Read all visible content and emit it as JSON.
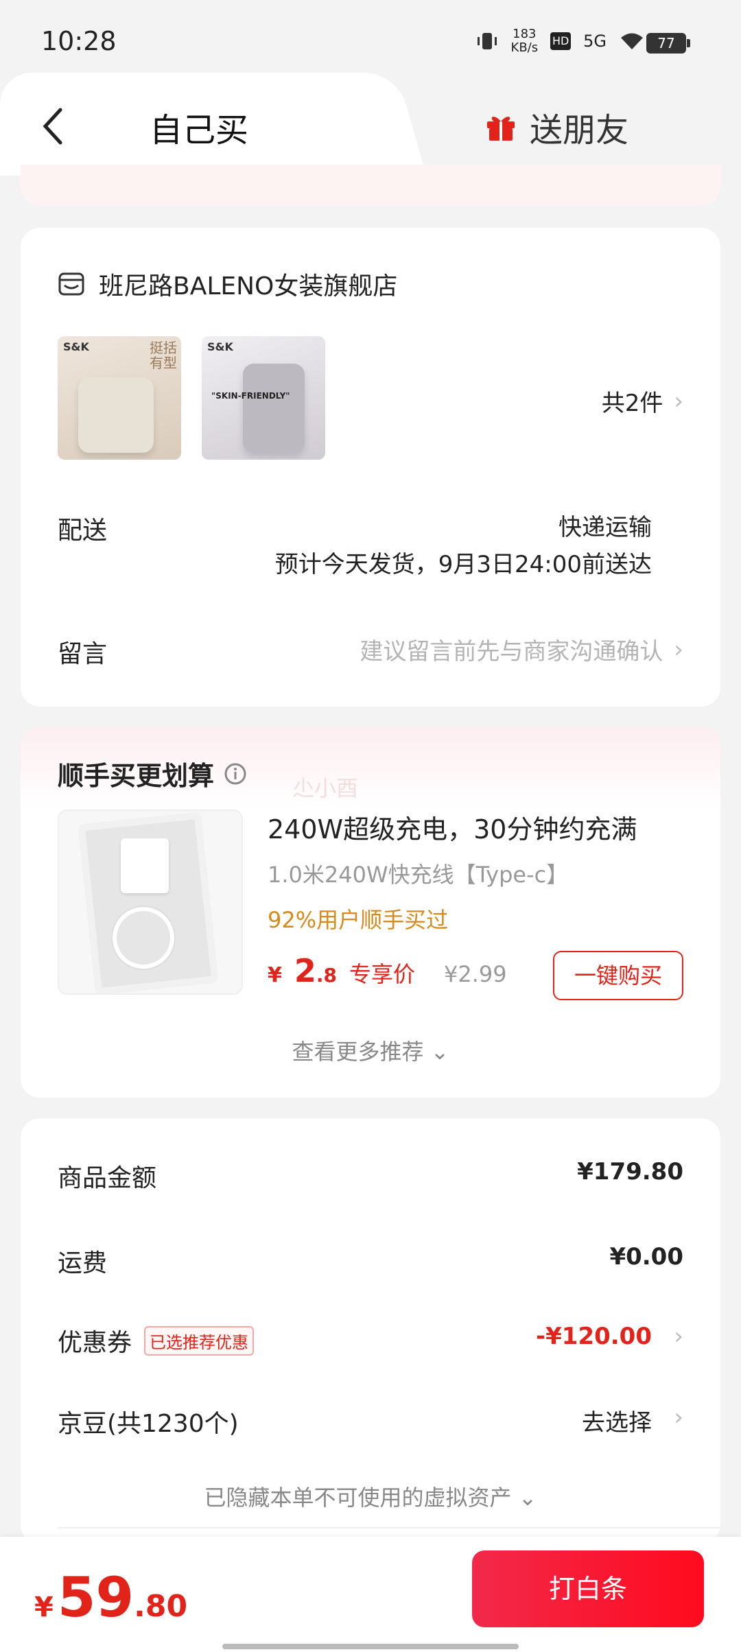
{
  "status_bar": {
    "time": "10:28",
    "net_speed_value": "183",
    "net_speed_unit": "KB/s",
    "hd": "HD",
    "network": "5G",
    "battery": "77"
  },
  "tabs": {
    "self_label": "自己买",
    "friend_label": "送朋友"
  },
  "shop": {
    "name": "班尼路BALENO女装旗舰店",
    "thumbs": [
      {
        "brand": "S&K",
        "tag": "挺括有型"
      },
      {
        "brand": "S&K",
        "tag": "\"SKIN-FRIENDLY\""
      }
    ],
    "count_label": "共2件",
    "delivery_label": "配送",
    "delivery_method": "快递运输",
    "delivery_eta": "预计今天发货，9月3日24:00前送达",
    "message_label": "留言",
    "message_placeholder": "建议留言前先与商家沟通确认"
  },
  "recommend": {
    "title": "顺手买更划算",
    "watermark": "尐小酉",
    "product_name": "240W超级充电，30分钟约充满",
    "product_spec": "1.0米240W快充线【Type-c】",
    "social_proof": "92%用户顺手买过",
    "price_currency": "¥",
    "price_int": "2",
    "price_dec": ".8",
    "price_tag": "专享价",
    "original_price": "¥2.99",
    "buy_label": "一键购买",
    "more_label": "查看更多推荐 ⌄"
  },
  "summary": {
    "goods_label": "商品金额",
    "goods_value": "¥179.80",
    "shipping_label": "运费",
    "shipping_value": "¥0.00",
    "coupon_label": "优惠券",
    "coupon_badge": "已选推荐优惠",
    "coupon_value": "-¥120.00",
    "beans_label": "京豆(共1230个)",
    "beans_value": "去选择",
    "hidden_assets": "已隐藏本单不可使用的虚拟资产 ⌄"
  },
  "footer": {
    "total_currency": "¥",
    "total_int": "59",
    "total_dec": ".80",
    "pay_label": "打白条"
  },
  "colors": {
    "accent_red": "#e2231a",
    "pay_button": "#f2294a",
    "social_orange": "#d78a1a"
  }
}
